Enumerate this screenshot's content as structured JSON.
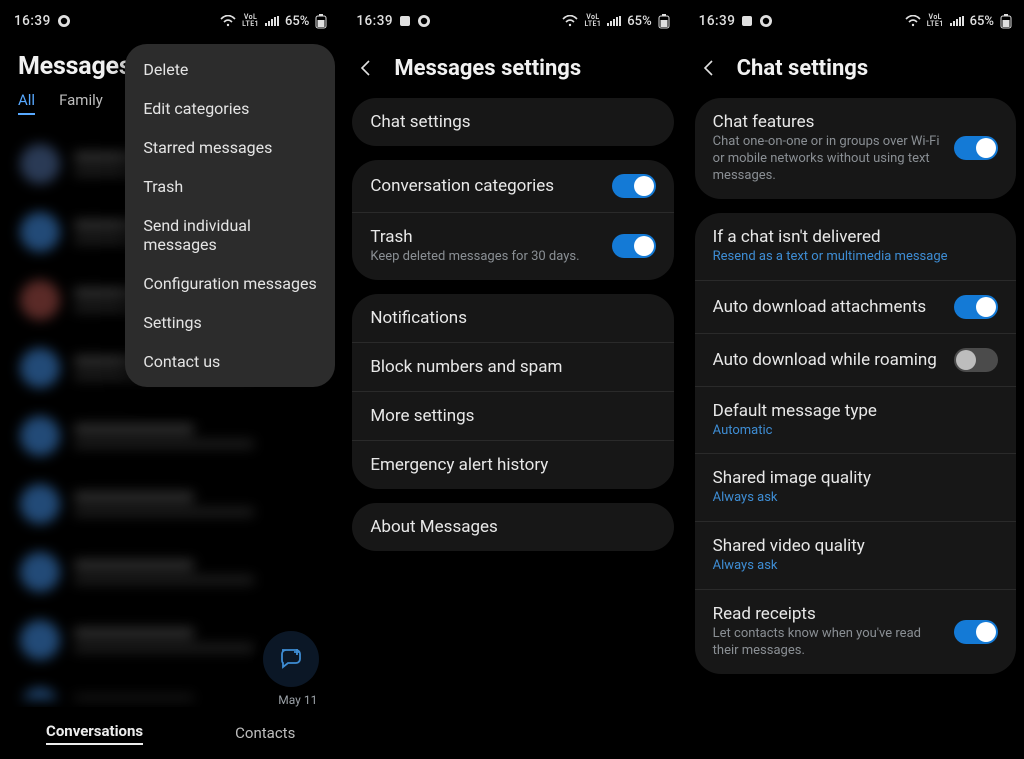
{
  "status": {
    "time": "16:39",
    "battery_pct": "65%",
    "net_top": "VoL",
    "net_bot": "LTE1"
  },
  "phone1": {
    "title": "Messages",
    "tabs": {
      "all": "All",
      "family": "Family"
    },
    "menu": {
      "delete": "Delete",
      "edit_categories": "Edit categories",
      "starred": "Starred messages",
      "trash": "Trash",
      "send_individual": "Send individual messages",
      "configuration": "Configuration messages",
      "settings": "Settings",
      "contact_us": "Contact us"
    },
    "fab_date": "May 11",
    "bottom": {
      "conversations": "Conversations",
      "contacts": "Contacts"
    }
  },
  "phone2": {
    "title": "Messages settings",
    "chat_settings": "Chat settings",
    "conversation_categories": "Conversation categories",
    "trash": {
      "title": "Trash",
      "sub": "Keep deleted messages for 30 days."
    },
    "notifications": "Notifications",
    "block_spam": "Block numbers and spam",
    "more_settings": "More settings",
    "emergency": "Emergency alert history",
    "about": "About Messages"
  },
  "phone3": {
    "title": "Chat settings",
    "chat_features": {
      "title": "Chat features",
      "sub": "Chat one-on-one or in groups over Wi-Fi or mobile networks without using text messages."
    },
    "not_delivered": {
      "title": "If a chat isn't delivered",
      "sub": "Resend as a text or multimedia message"
    },
    "auto_download": "Auto download attachments",
    "auto_download_roaming": "Auto download while roaming",
    "default_msg_type": {
      "title": "Default message type",
      "sub": "Automatic"
    },
    "image_quality": {
      "title": "Shared image quality",
      "sub": "Always ask"
    },
    "video_quality": {
      "title": "Shared video quality",
      "sub": "Always ask"
    },
    "read_receipts": {
      "title": "Read receipts",
      "sub": "Let contacts know when you've read their messages."
    }
  }
}
